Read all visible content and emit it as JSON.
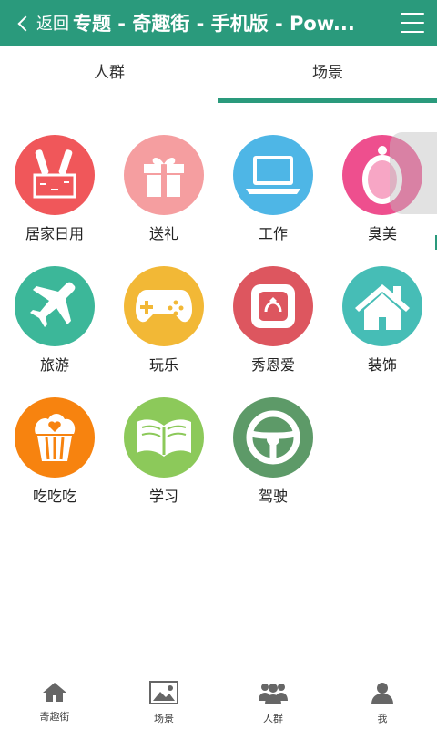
{
  "header": {
    "back_label": "返回",
    "title": "专题 - 奇趣街 - 手机版 - Pow..."
  },
  "tabs": [
    {
      "label": "人群",
      "active": false
    },
    {
      "label": "场景",
      "active": true
    }
  ],
  "categories": [
    {
      "label": "居家日用",
      "icon": "bottles-icon",
      "color": "#f0575a"
    },
    {
      "label": "送礼",
      "icon": "gift-icon",
      "color": "#f59ea0"
    },
    {
      "label": "工作",
      "icon": "laptop-icon",
      "color": "#4eb6e6"
    },
    {
      "label": "臭美",
      "icon": "mirror-icon",
      "color": "#ee4f8e"
    },
    {
      "label": "旅游",
      "icon": "airplane-icon",
      "color": "#3cb799"
    },
    {
      "label": "玩乐",
      "icon": "gamepad-icon",
      "color": "#f2b836"
    },
    {
      "label": "秀恩爱",
      "icon": "ring-box-icon",
      "color": "#dd565f"
    },
    {
      "label": "装饰",
      "icon": "house-icon",
      "color": "#46bdb6"
    },
    {
      "label": "吃吃吃",
      "icon": "cupcake-icon",
      "color": "#f7830f"
    },
    {
      "label": "学习",
      "icon": "book-icon",
      "color": "#8cc95a"
    },
    {
      "label": "驾驶",
      "icon": "steering-wheel-icon",
      "color": "#5d9a68"
    }
  ],
  "bottom_nav": [
    {
      "label": "奇趣街",
      "icon": "home-icon"
    },
    {
      "label": "场景",
      "icon": "image-icon"
    },
    {
      "label": "人群",
      "icon": "group-icon"
    },
    {
      "label": "我",
      "icon": "user-icon"
    }
  ],
  "colors": {
    "accent": "#2a9a7c"
  }
}
